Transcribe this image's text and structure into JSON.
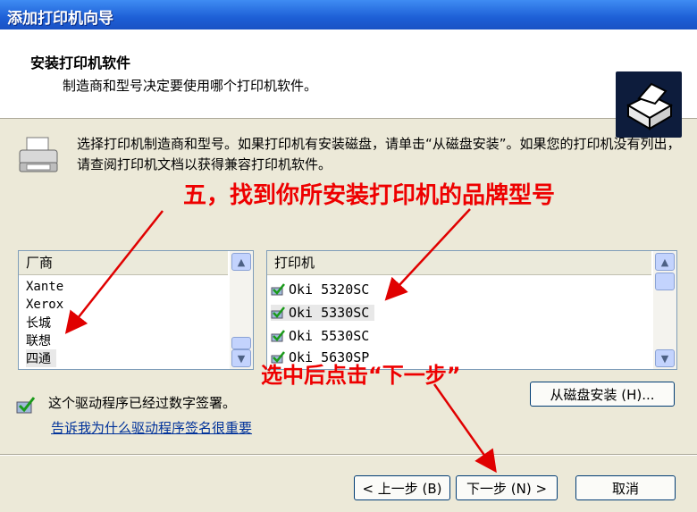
{
  "window": {
    "title": "添加打印机向导"
  },
  "header": {
    "title": "安装打印机软件",
    "subtitle": "制造商和型号决定要使用哪个打印机软件。"
  },
  "intro": {
    "text": "选择打印机制造商和型号。如果打印机有安装磁盘，请单击“从磁盘安装”。如果您的打印机没有列出，请查阅打印机文档以获得兼容打印机软件。"
  },
  "annotations": {
    "step5": "五，找到你所安装打印机的品牌型号",
    "select_next": "选中后点击“下一步”",
    "color": "#e00000"
  },
  "manufacturers": {
    "header": "厂商",
    "items": [
      "Xante",
      "Xerox",
      "长城",
      "联想",
      "四通"
    ],
    "selected": "四通"
  },
  "printers": {
    "header": "打印机",
    "items": [
      "Oki 5320SC",
      "Oki 5330SC",
      "Oki 5530SC",
      "Oki 5630SP"
    ],
    "selected": "Oki 5330SC"
  },
  "buttons": {
    "have_disk": "从磁盘安装 (H)...",
    "back": "< 上一步 (B)",
    "next": "下一步 (N) >",
    "cancel": "取消"
  },
  "signature": {
    "status": "这个驱动程序已经过数字签署。",
    "link": "告诉我为什么驱动程序签名很重要"
  },
  "icons": [
    "printer-wizard-icon",
    "printer-icon",
    "signed-driver-icon",
    "scroll-up-icon",
    "scroll-down-icon"
  ]
}
